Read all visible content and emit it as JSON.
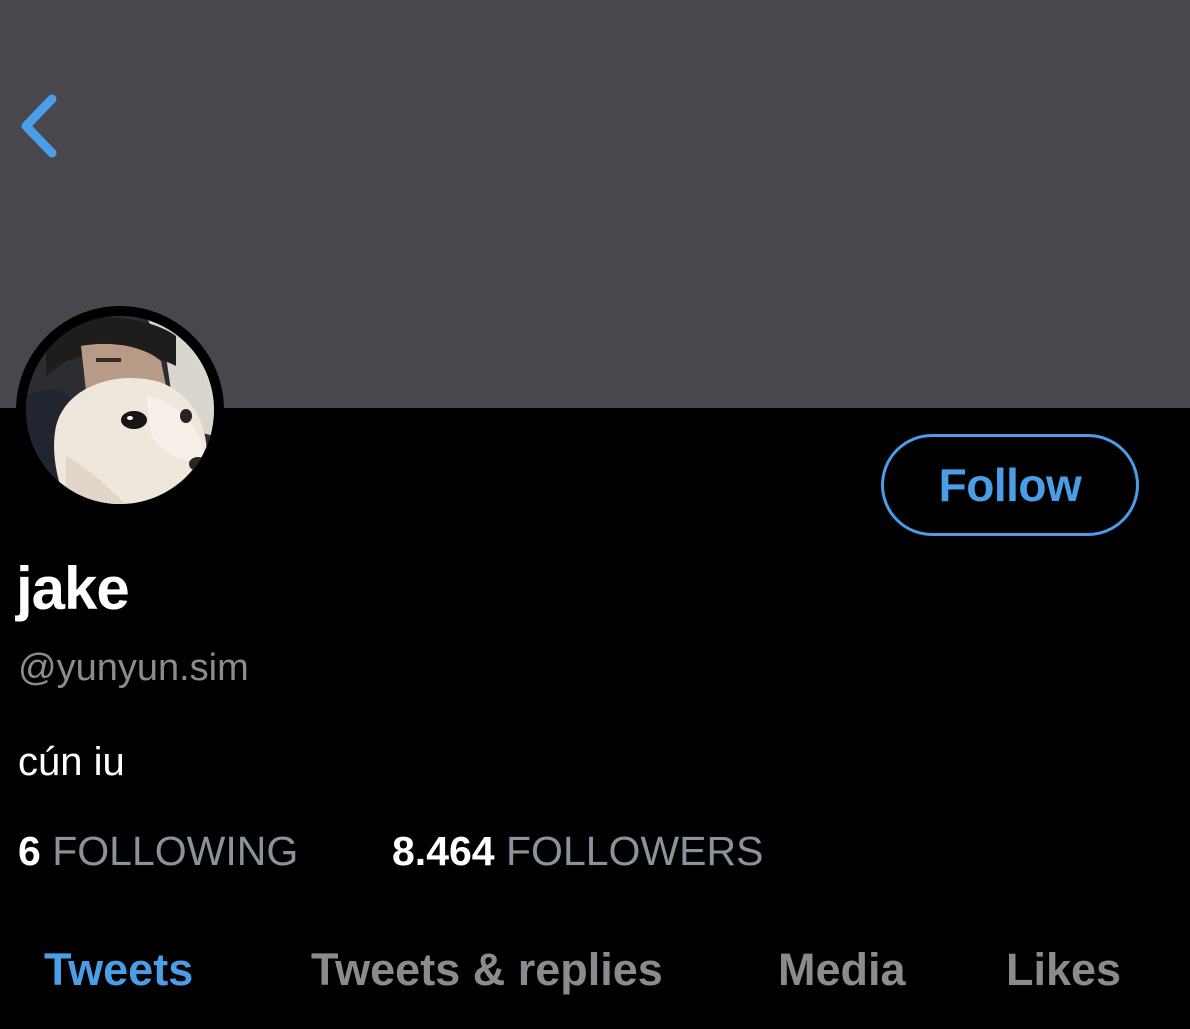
{
  "header": {
    "back_icon": "chevron-left-icon",
    "banner_color": "#48474d"
  },
  "profile": {
    "avatar": "dog-and-person-photo",
    "display_name": "jake",
    "handle": "@yunyun.sim",
    "bio": "cún iu",
    "follow_label": "Follow",
    "accent_color": "#4a9ee8"
  },
  "stats": {
    "following_count": "6",
    "following_label": "FOLLOWING",
    "followers_count": "8.464",
    "followers_label": "FOLLOWERS"
  },
  "tabs": [
    {
      "label": "Tweets",
      "active": true
    },
    {
      "label": "Tweets & replies",
      "active": false
    },
    {
      "label": "Media",
      "active": false
    },
    {
      "label": "Likes",
      "active": false
    }
  ]
}
